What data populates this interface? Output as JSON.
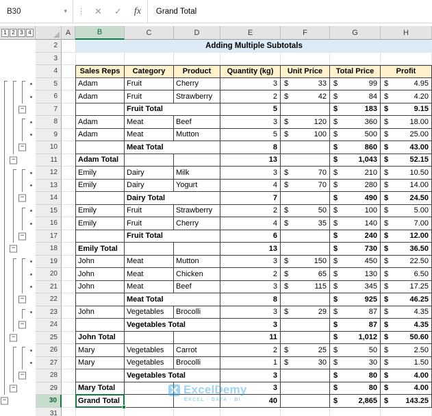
{
  "formula_bar": {
    "name_box": "B30",
    "dropdown_icon": "▾",
    "handle_icon": "⋮",
    "cancel_icon": "✕",
    "enter_icon": "✓",
    "fx_icon": "fx",
    "formula": "Grand Total"
  },
  "sheet": {
    "outline_buttons": [
      "1",
      "2",
      "3",
      "4"
    ],
    "columns": [
      "A",
      "B",
      "C",
      "D",
      "E",
      "F",
      "G",
      "H"
    ],
    "selected": {
      "cell": "B30",
      "column": "B",
      "row": 30
    },
    "title": "Adding Multiple Subtotals",
    "table_headers": [
      "Sales Reps",
      "Category",
      "Product",
      "Quantity (kg)",
      "Unit Price",
      "Total Price",
      "Profit"
    ],
    "rows": [
      {
        "n": 2,
        "type": "title"
      },
      {
        "n": 3,
        "type": "blank"
      },
      {
        "n": 4,
        "type": "header"
      },
      {
        "n": 5,
        "type": "detail",
        "cells": [
          "Adam",
          "Fruit",
          "Cherry",
          "3",
          "33",
          "99",
          "4.95"
        ],
        "outline": [
          "start",
          "start",
          "start",
          "dot"
        ]
      },
      {
        "n": 6,
        "type": "detail",
        "cells": [
          "Adam",
          "Fruit",
          "Strawberry",
          "2",
          "42",
          "84",
          "4.20"
        ],
        "outline": [
          "line",
          "line",
          "line",
          "dot"
        ]
      },
      {
        "n": 7,
        "type": "cat-total",
        "cells": [
          "",
          "Fruit Total",
          "",
          "5",
          "",
          "183",
          "9.15"
        ],
        "outline": [
          "line",
          "line",
          "minus",
          ""
        ]
      },
      {
        "n": 8,
        "type": "detail",
        "cells": [
          "Adam",
          "Meat",
          "Beef",
          "3",
          "120",
          "360",
          "18.00"
        ],
        "outline": [
          "line",
          "line",
          "start",
          "dot"
        ]
      },
      {
        "n": 9,
        "type": "detail",
        "cells": [
          "Adam",
          "Meat",
          "Mutton",
          "5",
          "100",
          "500",
          "25.00"
        ],
        "outline": [
          "line",
          "line",
          "line",
          "dot"
        ]
      },
      {
        "n": 10,
        "type": "cat-total",
        "cells": [
          "",
          "Meat Total",
          "",
          "8",
          "",
          "860",
          "43.00"
        ],
        "outline": [
          "line",
          "line",
          "minus",
          ""
        ]
      },
      {
        "n": 11,
        "type": "rep-total",
        "cells": [
          "Adam Total",
          "",
          "",
          "13",
          "",
          "1,043",
          "52.15"
        ],
        "outline": [
          "line",
          "minus",
          "",
          ""
        ]
      },
      {
        "n": 12,
        "type": "detail",
        "cells": [
          "Emily",
          "Dairy",
          "Milk",
          "3",
          "70",
          "210",
          "10.50"
        ],
        "outline": [
          "line",
          "start",
          "start",
          "dot"
        ]
      },
      {
        "n": 13,
        "type": "detail",
        "cells": [
          "Emily",
          "Dairy",
          "Yogurt",
          "4",
          "70",
          "280",
          "14.00"
        ],
        "outline": [
          "line",
          "line",
          "line",
          "dot"
        ]
      },
      {
        "n": 14,
        "type": "cat-total",
        "cells": [
          "",
          "Dairy Total",
          "",
          "7",
          "",
          "490",
          "24.50"
        ],
        "outline": [
          "line",
          "line",
          "minus",
          ""
        ]
      },
      {
        "n": 15,
        "type": "detail",
        "cells": [
          "Emily",
          "Fruit",
          "Strawberry",
          "2",
          "50",
          "100",
          "5.00"
        ],
        "outline": [
          "line",
          "line",
          "start",
          "dot"
        ]
      },
      {
        "n": 16,
        "type": "detail",
        "cells": [
          "Emily",
          "Fruit",
          "Cherry",
          "4",
          "35",
          "140",
          "7.00"
        ],
        "outline": [
          "line",
          "line",
          "line",
          "dot"
        ]
      },
      {
        "n": 17,
        "type": "cat-total",
        "cells": [
          "",
          "Fruit Total",
          "",
          "6",
          "",
          "240",
          "12.00"
        ],
        "outline": [
          "line",
          "line",
          "minus",
          ""
        ]
      },
      {
        "n": 18,
        "type": "rep-total",
        "cells": [
          "Emily Total",
          "",
          "",
          "13",
          "",
          "730",
          "36.50"
        ],
        "outline": [
          "line",
          "minus",
          "",
          ""
        ]
      },
      {
        "n": 19,
        "type": "detail",
        "cells": [
          "John",
          "Meat",
          "Mutton",
          "3",
          "150",
          "450",
          "22.50"
        ],
        "outline": [
          "line",
          "start",
          "start",
          "dot"
        ]
      },
      {
        "n": 20,
        "type": "detail",
        "cells": [
          "John",
          "Meat",
          "Chicken",
          "2",
          "65",
          "130",
          "6.50"
        ],
        "outline": [
          "line",
          "line",
          "line",
          "dot"
        ]
      },
      {
        "n": 21,
        "type": "detail",
        "cells": [
          "John",
          "Meat",
          "Beef",
          "3",
          "115",
          "345",
          "17.25"
        ],
        "outline": [
          "line",
          "line",
          "line",
          "dot"
        ]
      },
      {
        "n": 22,
        "type": "cat-total",
        "cells": [
          "",
          "Meat Total",
          "",
          "8",
          "",
          "925",
          "46.25"
        ],
        "outline": [
          "line",
          "line",
          "minus",
          ""
        ]
      },
      {
        "n": 23,
        "type": "detail",
        "cells": [
          "John",
          "Vegetables",
          "Brocolli",
          "3",
          "29",
          "87",
          "4.35"
        ],
        "outline": [
          "line",
          "line",
          "start",
          "dot"
        ]
      },
      {
        "n": 24,
        "type": "cat-total",
        "cells": [
          "",
          "Vegetables Total",
          "",
          "3",
          "",
          "87",
          "4.35"
        ],
        "outline": [
          "line",
          "line",
          "minus",
          ""
        ]
      },
      {
        "n": 25,
        "type": "rep-total",
        "cells": [
          "John Total",
          "",
          "",
          "11",
          "",
          "1,012",
          "50.60"
        ],
        "outline": [
          "line",
          "minus",
          "",
          ""
        ]
      },
      {
        "n": 26,
        "type": "detail",
        "cells": [
          "Mary",
          "Vegetables",
          "Carrot",
          "2",
          "25",
          "50",
          "2.50"
        ],
        "outline": [
          "line",
          "start",
          "start",
          "dot"
        ]
      },
      {
        "n": 27,
        "type": "detail",
        "cells": [
          "Mary",
          "Vegetables",
          "Brocolli",
          "1",
          "30",
          "30",
          "1.50"
        ],
        "outline": [
          "line",
          "line",
          "line",
          "dot"
        ]
      },
      {
        "n": 28,
        "type": "cat-total",
        "cells": [
          "",
          "Vegetables Total",
          "",
          "3",
          "",
          "80",
          "4.00"
        ],
        "outline": [
          "line",
          "line",
          "minus",
          ""
        ]
      },
      {
        "n": 29,
        "type": "rep-total",
        "cells": [
          "Mary Total",
          "",
          "",
          "3",
          "",
          "80",
          "4.00"
        ],
        "outline": [
          "line",
          "minus",
          "",
          ""
        ]
      },
      {
        "n": 30,
        "type": "grand",
        "cells": [
          "Grand Total",
          "",
          "",
          "40",
          "",
          "2,865",
          "143.25"
        ],
        "outline": [
          "minus",
          "",
          "",
          ""
        ]
      },
      {
        "n": 31,
        "type": "blank"
      }
    ]
  },
  "watermark": {
    "brand": "ExcelDemy",
    "tagline": "EXCEL · DATA · BI"
  },
  "colors": {
    "accent_green": "#107C41",
    "title_fill": "#DDEBF7",
    "table_header_fill": "#FFF2CC",
    "watermark_blue": "#2E9FD8",
    "table_border": "#3F3F3F"
  }
}
